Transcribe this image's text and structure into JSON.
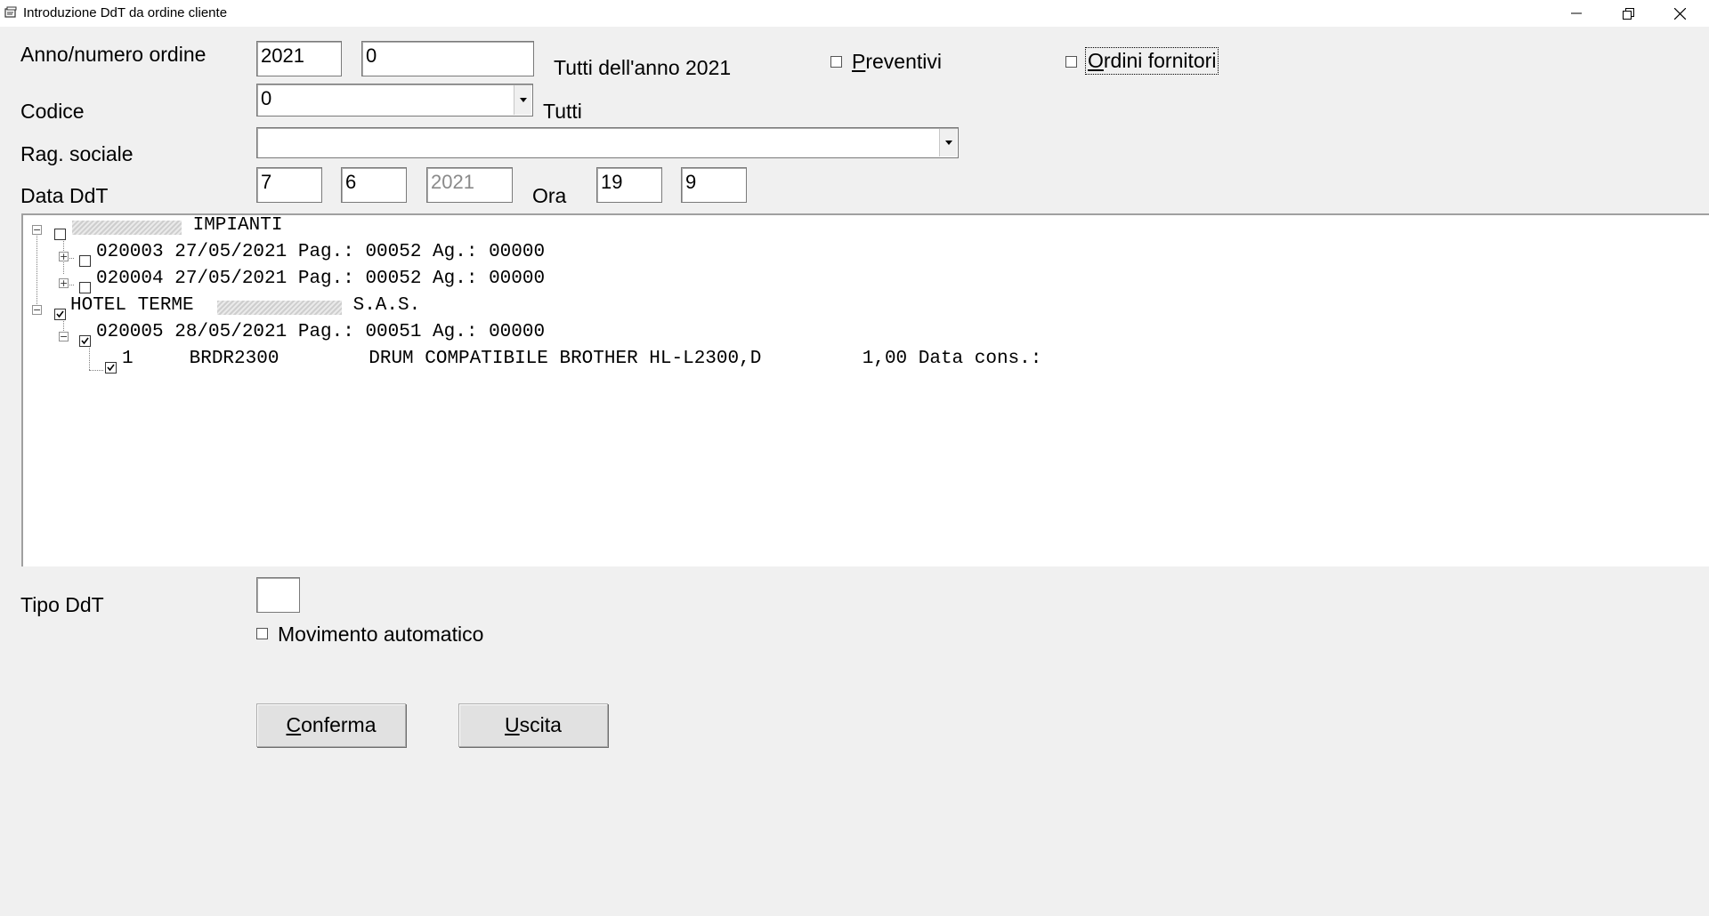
{
  "window": {
    "title": "Introduzione DdT da ordine cliente",
    "minimize_glyph": "—",
    "restore_glyph": "❐",
    "close_glyph": "✕"
  },
  "form": {
    "anno_numero_label": "Anno/numero ordine",
    "anno_value": "2021",
    "numero_value": "0",
    "tutti_anno_text": "Tutti dell'anno 2021",
    "preventivi_label": "Preventivi",
    "preventivi_mnemonic": "P",
    "preventivi_rest": "reventivi",
    "ordini_fornitori_label": "Ordini fornitori",
    "ordini_mnemonic": "O",
    "ordini_rest": "rdini fornitori",
    "codice_label": "Codice",
    "codice_value": "0",
    "tutti_text": "Tutti",
    "rag_sociale_label": "Rag. sociale",
    "rag_sociale_value": "",
    "data_ddt_label": "Data DdT",
    "giorno_value": "7",
    "mese_value": "6",
    "anno_ddt_value": "2021",
    "ora_label": "Ora",
    "ora_value": "19",
    "minuti_value": "9",
    "tipo_ddt_label": "Tipo DdT",
    "tipo_ddt_value": "",
    "movimento_label": "Movimento automatico"
  },
  "tree": {
    "nodes": [
      {
        "text": " IMPIANTI",
        "checked": false
      },
      {
        "text": "020003 27/05/2021 Pag.: 00052 Ag.: 00000",
        "checked": false
      },
      {
        "text": "020004 27/05/2021 Pag.: 00052 Ag.: 00000",
        "checked": false
      },
      {
        "text_prefix": "HOTEL TERME ",
        "text_suffix": " S.A.S.",
        "checked": true
      },
      {
        "text": "020005 28/05/2021 Pag.: 00051 Ag.: 00000",
        "checked": true
      },
      {
        "text": "1     BRDR2300        DRUM COMPATIBILE BROTHER HL-L2300,D         1,00 Data cons.:",
        "checked": true
      }
    ]
  },
  "buttons": {
    "conferma_mnemonic": "C",
    "conferma_rest": "onferma",
    "uscita_mnemonic": "U",
    "uscita_rest": "scita"
  }
}
